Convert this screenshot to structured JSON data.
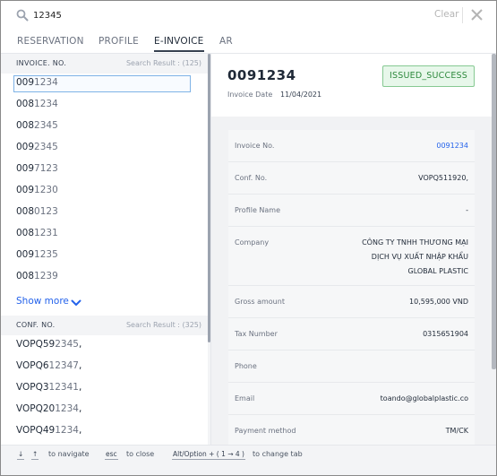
{
  "search": {
    "value": "12345",
    "clear_label": "Clear"
  },
  "tabs": [
    {
      "label": "RESERVATION",
      "active": false
    },
    {
      "label": "PROFILE",
      "active": false
    },
    {
      "label": "E-INVOICE",
      "active": true
    },
    {
      "label": "AR",
      "active": false
    }
  ],
  "invoice_section": {
    "title": "INVOICE. NO.",
    "count": "Search Result : (125)",
    "items": [
      [
        "009",
        "1234"
      ],
      [
        "008",
        "1234"
      ],
      [
        "008",
        "2345"
      ],
      [
        "009",
        "2345"
      ],
      [
        "009",
        "7123"
      ],
      [
        "009",
        "1230"
      ],
      [
        "008",
        "0123"
      ],
      [
        "008",
        "1231"
      ],
      [
        "009",
        "1235"
      ],
      [
        "008",
        "1239"
      ]
    ],
    "show_more": "Show more"
  },
  "conf_section": {
    "title": "CONF. NO.",
    "count": "Search Result : (325)",
    "items": [
      [
        "VOPQ59",
        "2345",
        ","
      ],
      [
        "VOPQ6",
        "12347",
        ","
      ],
      [
        "VOPQ3",
        "12341",
        ","
      ],
      [
        "VOPQ20",
        "1234",
        ","
      ],
      [
        "VOPQ49",
        "1234",
        ","
      ]
    ]
  },
  "detail": {
    "number": "0091234",
    "date_label": "Invoice Date",
    "date": "11/04/2021",
    "status": "ISSUED_SUCCESS",
    "fields": [
      {
        "label": "Invoice No.",
        "value": "0091234",
        "link": true
      },
      {
        "label": "Conf. No.",
        "value": "VOPQ511920,"
      },
      {
        "label": "Profile Name",
        "value": "-"
      },
      {
        "label": "Company",
        "value": "CÔNG TY TNHH THƯƠNG MẠI\nDỊCH VỤ XUẤT NHẬP KHẨU\nGLOBAL PLASTIC"
      },
      {
        "label": "Gross amount",
        "value": "10,595,000 VND"
      },
      {
        "label": "Tax Number",
        "value": "0315651904"
      },
      {
        "label": "Phone",
        "value": ""
      },
      {
        "label": "Email",
        "value": "toando@globalplastic.co"
      },
      {
        "label": "Payment method",
        "value": "TM/CK"
      }
    ]
  },
  "footer": {
    "down_key": "↓",
    "up_key": "↑",
    "navigate_text": "to navigate",
    "esc_key": "esc",
    "close_text": "to close",
    "alt_key": "Alt/Option + ( 1 → 4 )",
    "tab_text": "to change tab"
  }
}
